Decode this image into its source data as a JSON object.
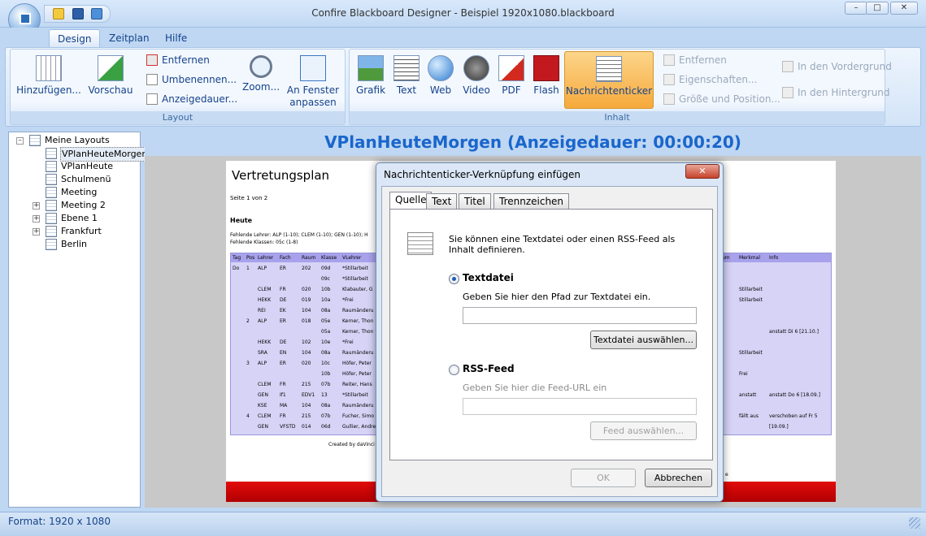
{
  "window": {
    "title": "Confire Blackboard Designer - Beispiel 1920x1080.blackboard"
  },
  "ribbon": {
    "tabs": [
      "Design",
      "Zeitplan",
      "Hilfe"
    ],
    "layout_group": {
      "label": "Layout",
      "add": "Hinzufügen...",
      "preview": "Vorschau",
      "remove": "Entfernen",
      "rename": "Umbenennen...",
      "duration": "Anzeigedauer...",
      "zoom": "Zoom...",
      "fit_line1": "An Fenster",
      "fit_line2": "anpassen"
    },
    "content_group": {
      "label": "Inhalt",
      "items": [
        "Grafik",
        "Text",
        "Web",
        "Video",
        "PDF",
        "Flash",
        "Nachrichtenticker"
      ],
      "remove": "Entfernen",
      "properties": "Eigenschaften...",
      "size_pos": "Größe und Position..."
    },
    "arrange": {
      "front": "In den Vordergrund",
      "back": "In den Hintergrund"
    }
  },
  "tree": {
    "root": "Meine Layouts",
    "items": [
      "VPlanHeuteMorgen",
      "VPlanHeute",
      "Schulmenü",
      "Meeting",
      "Meeting 2",
      "Ebene 1",
      "Frankfurt",
      "Berlin"
    ]
  },
  "canvas": {
    "header": "VPlanHeuteMorgen (Anzeigedauer: 00:00:20)"
  },
  "preview": {
    "title": "Vertretungsplan",
    "page": "Seite 1 von 2",
    "heute": "Heute",
    "teachers_absent": "Fehlende Lehrer: ALP (1-10); CLEM (1-10); GEN (1-10); H",
    "classes_absent": "Fehlende Klassen: 05c (1-8)",
    "headers": [
      "Tag",
      "Pos",
      "Lehrer",
      "Fach",
      "Raum",
      "Klasse",
      "VLehrer"
    ],
    "headers_right": [
      "um",
      "Merkmal",
      "Info"
    ],
    "rows": [
      [
        "Do",
        "1",
        "ALP",
        "ER",
        "202",
        "09d",
        "*Stillarbeit"
      ],
      [
        "",
        "",
        "",
        "",
        "",
        "09c",
        "*Stillarbeit"
      ],
      [
        "",
        "",
        "CLEM",
        "FR",
        "020",
        "10b",
        "Klabauter, G"
      ],
      [
        "",
        "",
        "HEKK",
        "DE",
        "019",
        "10a",
        "*Frei"
      ],
      [
        "",
        "",
        "REI",
        "EK",
        "104",
        "08a",
        "Raumänderu"
      ],
      [
        "",
        "2",
        "ALP",
        "ER",
        "018",
        "05e",
        "Kerner, Thon"
      ],
      [
        "",
        "",
        "",
        "",
        "",
        "05a",
        "Kerner, Thon"
      ],
      [
        "",
        "",
        "HEKK",
        "DE",
        "102",
        "10e",
        "*Frei"
      ],
      [
        "",
        "",
        "SRA",
        "EN",
        "104",
        "08a",
        "Raumänderu"
      ],
      [
        "",
        "3",
        "ALP",
        "ER",
        "020",
        "10c",
        "Höfer, Peter"
      ],
      [
        "",
        "",
        "",
        "",
        "",
        "10b",
        "Höfer, Peter"
      ],
      [
        "",
        "",
        "CLEM",
        "FR",
        "215",
        "07b",
        "Reiter, Hans"
      ],
      [
        "",
        "",
        "GEN",
        "If1",
        "EDV1",
        "13",
        "*Stillarbeit"
      ],
      [
        "",
        "",
        "KSE",
        "MA",
        "104",
        "08a",
        "Raumänderu"
      ],
      [
        "",
        "4",
        "CLEM",
        "FR",
        "215",
        "07b",
        "Fucher, Simo"
      ],
      [
        "",
        "",
        "GEN",
        "VFSTD",
        "014",
        "06d",
        "Gullier, Andre"
      ]
    ],
    "right_notes": [
      {
        "row": 3,
        "merkmal": "Stillarbeit",
        "info": ""
      },
      {
        "row": 4,
        "merkmal": "Stillarbeit",
        "info": ""
      },
      {
        "row": 7,
        "merkmal": "",
        "info": "anstatt Di 6 [21.10.]"
      },
      {
        "row": 9,
        "merkmal": "Stillarbeit",
        "info": ""
      },
      {
        "row": 11,
        "merkmal": "Frei",
        "info": ""
      },
      {
        "row": 13,
        "merkmal": "anstatt",
        "info": "anstatt Do 6 [18.09.]"
      },
      {
        "row": 15,
        "merkmal": "fällt aus",
        "info": "verschoben auf Fr 5"
      },
      {
        "row": 16,
        "merkmal": "",
        "info": "[19.09.]"
      }
    ],
    "created": "Created by daVinci",
    "footer_tail": "e"
  },
  "dialog": {
    "title": "Nachrichtenticker-Verknüpfung einfügen",
    "tabs": [
      "Quelle",
      "Text",
      "Titel",
      "Trennzeichen"
    ],
    "intro": "Sie können eine Textdatei oder einen RSS-Feed als Inhalt definieren.",
    "textfile_label": "Textdatei",
    "textfile_hint": "Geben Sie hier den Pfad zur Textdatei ein.",
    "textfile_value": "",
    "textfile_button": "Textdatei auswählen...",
    "rss_label": "RSS-Feed",
    "rss_hint": "Geben Sie hier die Feed-URL ein",
    "rss_value": "",
    "rss_button": "Feed auswählen...",
    "ok": "OK",
    "cancel": "Abbrechen"
  },
  "status": {
    "format": "Format: 1920 x 1080"
  }
}
